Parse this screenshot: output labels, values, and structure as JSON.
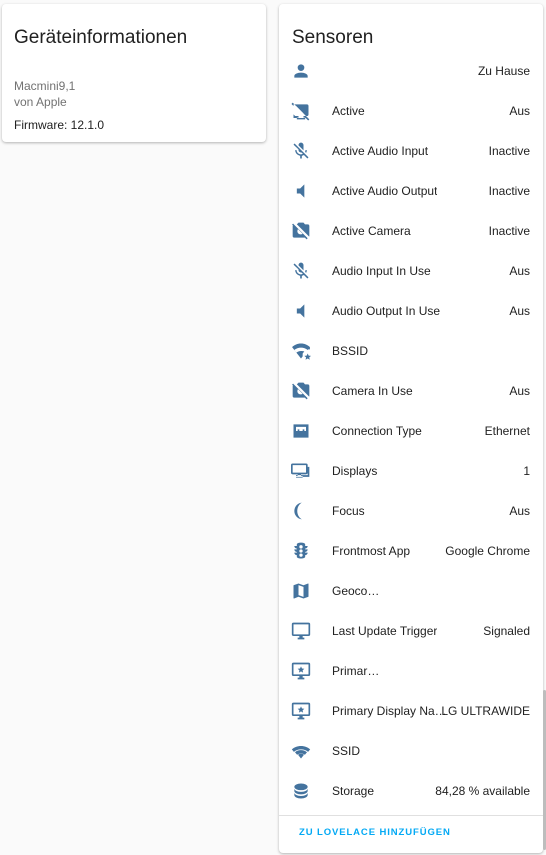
{
  "device_card": {
    "title": "Geräteinformationen",
    "model": "Macmini9,1",
    "manufacturer": "von Apple",
    "firmware": "Firmware: 12.1.0"
  },
  "sensor_card": {
    "title": "Sensoren",
    "icon_color": "#44739e",
    "rows": [
      {
        "icon": "account-icon",
        "name": "",
        "value": "Zu Hause"
      },
      {
        "icon": "monitor-off-icon",
        "name": "Active",
        "value": "Aus"
      },
      {
        "icon": "microphone-off-icon",
        "name": "Active Audio Input",
        "value": "Inactive"
      },
      {
        "icon": "volume-icon",
        "name": "Active Audio Output",
        "value": "Inactive"
      },
      {
        "icon": "camera-off-icon",
        "name": "Active Camera",
        "value": "Inactive"
      },
      {
        "icon": "microphone-off-icon",
        "name": "Audio Input In Use",
        "value": "Aus"
      },
      {
        "icon": "volume-icon",
        "name": "Audio Output In Use",
        "value": "Aus"
      },
      {
        "icon": "wifi-star-icon",
        "name": "BSSID",
        "value": ""
      },
      {
        "icon": "camera-off-icon",
        "name": "Camera In Use",
        "value": "Aus"
      },
      {
        "icon": "ethernet-icon",
        "name": "Connection Type",
        "value": "Ethernet"
      },
      {
        "icon": "monitor-multiple-icon",
        "name": "Displays",
        "value": "1"
      },
      {
        "icon": "moon-icon",
        "name": "Focus",
        "value": "Aus"
      },
      {
        "icon": "traffic-light-icon",
        "name": "Frontmost App",
        "value": "Google Chrome"
      },
      {
        "icon": "map-icon",
        "name": "Geoco…",
        "value": ""
      },
      {
        "icon": "monitor-icon",
        "name": "Last Update Trigger",
        "value": "Signaled"
      },
      {
        "icon": "monitor-star-icon",
        "name": "Primar…",
        "value": ""
      },
      {
        "icon": "monitor-star-icon",
        "name": "Primary Display Na…",
        "value": "LG ULTRAWIDE"
      },
      {
        "icon": "wifi-icon",
        "name": "SSID",
        "value": ""
      },
      {
        "icon": "database-icon",
        "name": "Storage",
        "value": "84,28 % available"
      }
    ],
    "action_button": "ZU LOVELACE HINZUFÜGEN"
  },
  "colors": {
    "accent": "#03a9f4",
    "icon": "#44739e",
    "background": "#fafafa"
  }
}
